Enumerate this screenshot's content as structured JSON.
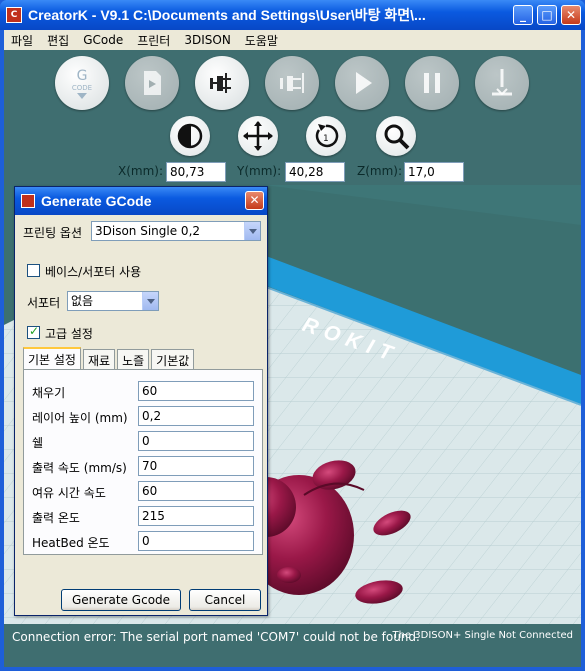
{
  "window": {
    "app_icon_text": "C",
    "title": "CreatorK - V9.1  C:\\Documents and Settings\\User\\바탕 화면\\..."
  },
  "menu": [
    "파일",
    "편집",
    "GCode",
    "프린터",
    "3DISON",
    "도움말"
  ],
  "toolbar": {
    "gcode_label_top": "G",
    "gcode_label_bottom": "CODE"
  },
  "coords": {
    "x_label": "X(mm):",
    "x_value": "80,73",
    "y_label": "Y(mm):",
    "y_value": "40,28",
    "z_label": "Z(mm):",
    "z_value": "17,0"
  },
  "scene": {
    "brand_text": "ROKIT"
  },
  "dialog": {
    "title": "Generate GCode",
    "printing_option_label": "프린팅 옵션",
    "printing_option_value": "3Dison Single 0,2",
    "base_support_label": "베이스/서포터 사용",
    "support_label": "서포터",
    "support_value": "없음",
    "advanced_label": "고급 설정",
    "tabs": [
      "기본 설정",
      "재료",
      "노즐",
      "기본값"
    ],
    "rows": [
      {
        "label": "채우기",
        "value": "60"
      },
      {
        "label": "레이어 높이 (mm)",
        "value": "0,2"
      },
      {
        "label": "쉘",
        "value": "0"
      },
      {
        "label": "출력 속도 (mm/s)",
        "value": "70"
      },
      {
        "label": "여유 시간 속도",
        "value": "60"
      },
      {
        "label": "출력 온도",
        "value": "215"
      },
      {
        "label": "HeatBed 온도",
        "value": "0"
      }
    ],
    "generate_button": "Generate Gcode",
    "cancel_button": "Cancel"
  },
  "status": {
    "message": "Connection error: The serial port named 'COM7' could not be found.",
    "connection": "The 3DISON+ Single Not Connected"
  }
}
